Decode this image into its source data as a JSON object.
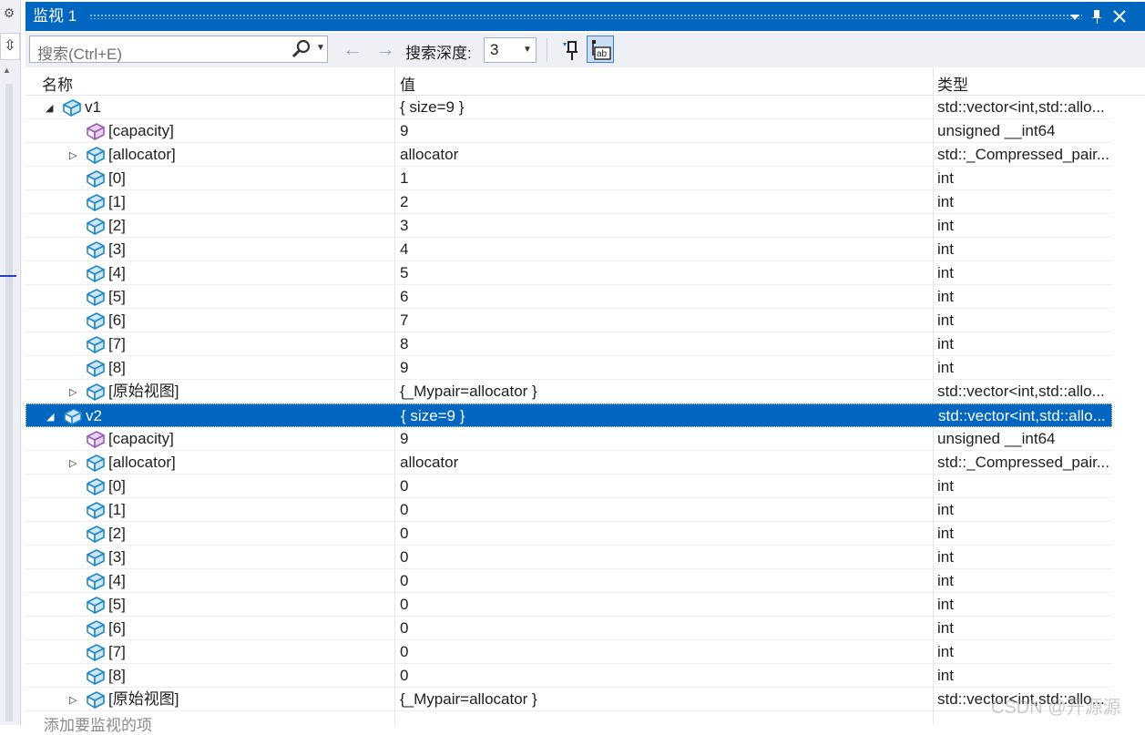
{
  "window": {
    "title": "监视 1",
    "menu_icon": "dropdown-icon",
    "pin_icon": "pin-icon",
    "close_icon": "close-icon"
  },
  "toolbar": {
    "search_placeholder": "搜索(Ctrl+E)",
    "back_icon": "back-arrow-icon",
    "forward_icon": "forward-arrow-icon",
    "depth_label": "搜索深度:",
    "depth_value": "3"
  },
  "columns": {
    "name": "名称",
    "value": "值",
    "type": "类型"
  },
  "rows": [
    {
      "name": "v1",
      "value": "{ size=9 }",
      "type": "std::vector<int,std::allo...",
      "expand": "expanded",
      "indent": 0,
      "icon": "cube"
    },
    {
      "name": "[capacity]",
      "value": "9",
      "type": "unsigned __int64",
      "expand": "none",
      "indent": 1,
      "icon": "purple-cube"
    },
    {
      "name": "[allocator]",
      "value": "allocator",
      "type": "std::_Compressed_pair...",
      "expand": "collapsed",
      "indent": 1,
      "icon": "cube"
    },
    {
      "name": "[0]",
      "value": "1",
      "type": "int",
      "expand": "none",
      "indent": 1,
      "icon": "cube"
    },
    {
      "name": "[1]",
      "value": "2",
      "type": "int",
      "expand": "none",
      "indent": 1,
      "icon": "cube"
    },
    {
      "name": "[2]",
      "value": "3",
      "type": "int",
      "expand": "none",
      "indent": 1,
      "icon": "cube"
    },
    {
      "name": "[3]",
      "value": "4",
      "type": "int",
      "expand": "none",
      "indent": 1,
      "icon": "cube"
    },
    {
      "name": "[4]",
      "value": "5",
      "type": "int",
      "expand": "none",
      "indent": 1,
      "icon": "cube"
    },
    {
      "name": "[5]",
      "value": "6",
      "type": "int",
      "expand": "none",
      "indent": 1,
      "icon": "cube"
    },
    {
      "name": "[6]",
      "value": "7",
      "type": "int",
      "expand": "none",
      "indent": 1,
      "icon": "cube"
    },
    {
      "name": "[7]",
      "value": "8",
      "type": "int",
      "expand": "none",
      "indent": 1,
      "icon": "cube"
    },
    {
      "name": "[8]",
      "value": "9",
      "type": "int",
      "expand": "none",
      "indent": 1,
      "icon": "cube"
    },
    {
      "name": "[原始视图]",
      "value": "{_Mypair=allocator }",
      "type": "std::vector<int,std::allo...",
      "expand": "collapsed",
      "indent": 1,
      "icon": "cube"
    },
    {
      "name": "v2",
      "value": "{ size=9 }",
      "type": "std::vector<int,std::allo...",
      "expand": "expanded",
      "indent": 0,
      "icon": "cube",
      "selected": true
    },
    {
      "name": "[capacity]",
      "value": "9",
      "type": "unsigned __int64",
      "expand": "none",
      "indent": 1,
      "icon": "purple-cube"
    },
    {
      "name": "[allocator]",
      "value": "allocator",
      "type": "std::_Compressed_pair...",
      "expand": "collapsed",
      "indent": 1,
      "icon": "cube"
    },
    {
      "name": "[0]",
      "value": "0",
      "type": "int",
      "expand": "none",
      "indent": 1,
      "icon": "cube"
    },
    {
      "name": "[1]",
      "value": "0",
      "type": "int",
      "expand": "none",
      "indent": 1,
      "icon": "cube"
    },
    {
      "name": "[2]",
      "value": "0",
      "type": "int",
      "expand": "none",
      "indent": 1,
      "icon": "cube"
    },
    {
      "name": "[3]",
      "value": "0",
      "type": "int",
      "expand": "none",
      "indent": 1,
      "icon": "cube"
    },
    {
      "name": "[4]",
      "value": "0",
      "type": "int",
      "expand": "none",
      "indent": 1,
      "icon": "cube"
    },
    {
      "name": "[5]",
      "value": "0",
      "type": "int",
      "expand": "none",
      "indent": 1,
      "icon": "cube"
    },
    {
      "name": "[6]",
      "value": "0",
      "type": "int",
      "expand": "none",
      "indent": 1,
      "icon": "cube"
    },
    {
      "name": "[7]",
      "value": "0",
      "type": "int",
      "expand": "none",
      "indent": 1,
      "icon": "cube"
    },
    {
      "name": "[8]",
      "value": "0",
      "type": "int",
      "expand": "none",
      "indent": 1,
      "icon": "cube"
    },
    {
      "name": "[原始视图]",
      "value": "{_Mypair=allocator }",
      "type": "std::vector<int,std::allo...",
      "expand": "collapsed",
      "indent": 1,
      "icon": "cube"
    }
  ],
  "add_watch": "添加要监视的项",
  "watermark": "CSDN @开源源",
  "colors": {
    "accent": "#0066c0",
    "cube": "#1e88c8",
    "purple_cube": "#9b59b6"
  }
}
